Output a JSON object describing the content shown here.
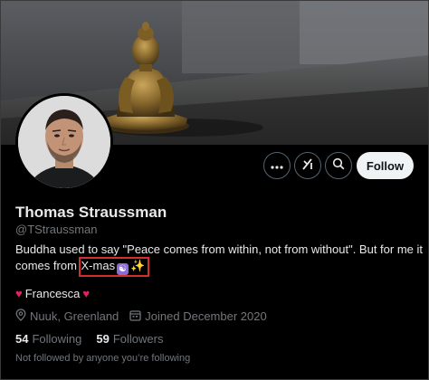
{
  "profile": {
    "name": "Thomas Straussman",
    "handle": "@TStraussman",
    "bio_prefix": "Buddha used to say \"Peace comes from within, not from without\". But for me it comes from ",
    "bio_highlight": "X-mas",
    "bio_emoji_1": "☯",
    "bio_emoji_2": "✨",
    "highlight_color": "#d32f2f",
    "affiliation": {
      "text": "Francesca",
      "heart_left": "♥",
      "heart_right": "♥"
    },
    "location": "Nuuk, Greenland",
    "joined": "Joined December 2020",
    "following_count": "54",
    "following_label": "Following",
    "followers_count": "59",
    "followers_label": "Followers",
    "not_followed": "Not followed by anyone you’re following"
  },
  "actions": {
    "more_icon": "more-icon",
    "grok_icon": "grok-icon",
    "search_icon": "search-icon",
    "follow_label": "Follow"
  },
  "colors": {
    "background": "#000000",
    "text": "#e7e9ea",
    "muted": "#71767b",
    "heart": "#e0245e",
    "follow_bg": "#eff3f4"
  }
}
